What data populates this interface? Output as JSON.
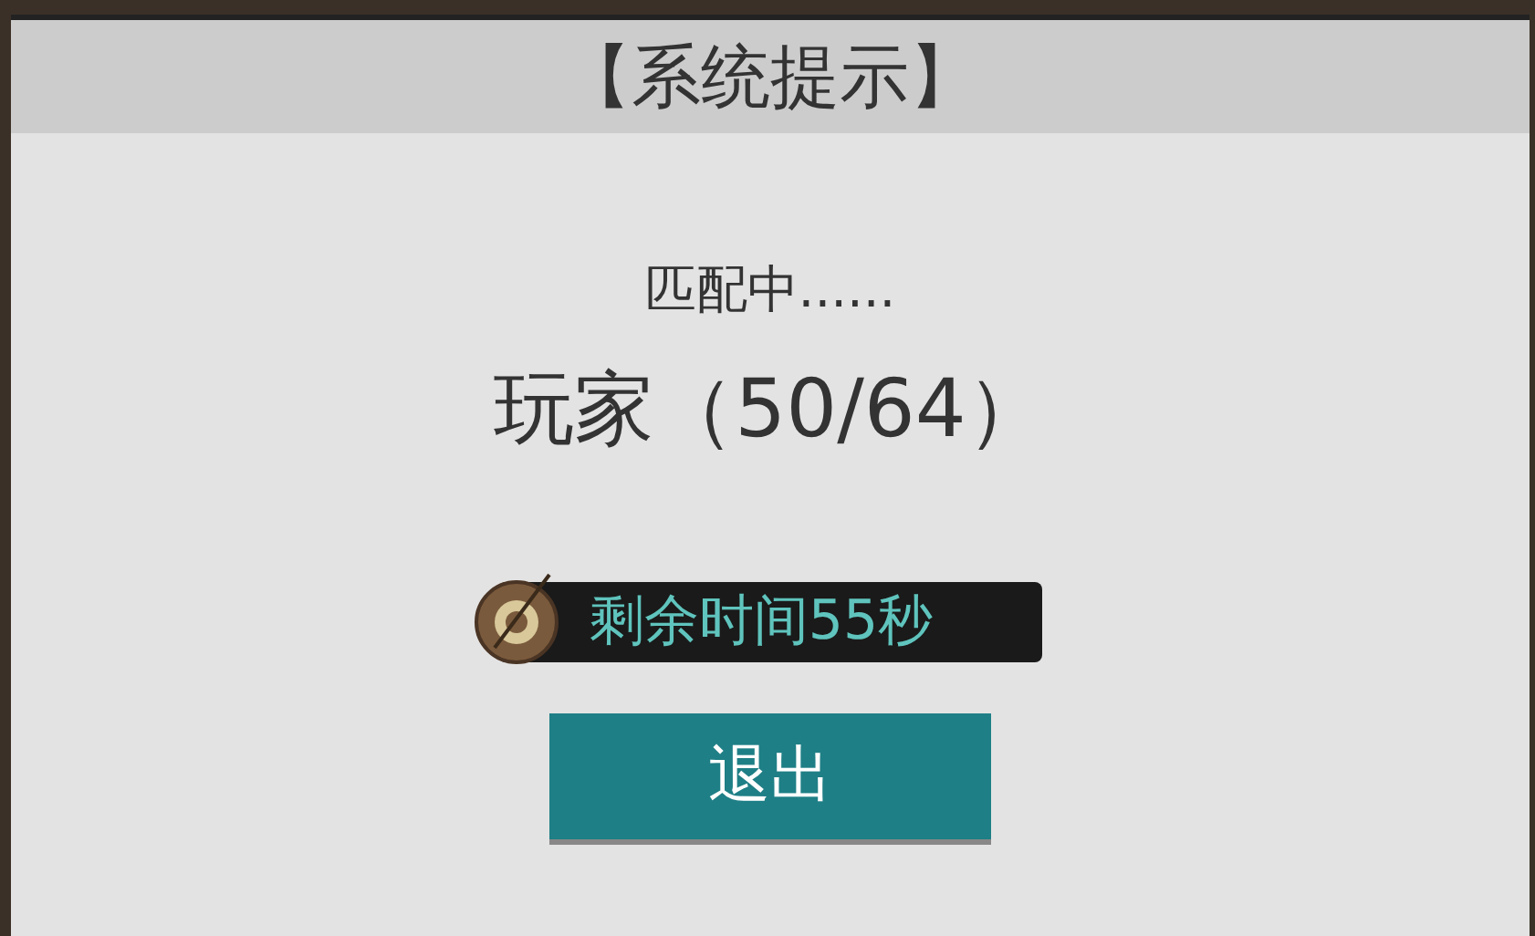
{
  "dialog": {
    "title": "【系统提示】",
    "status": "匹配中......",
    "players": "玩家（50/64）",
    "timer": "剩余时间55秒",
    "button": "退出"
  }
}
